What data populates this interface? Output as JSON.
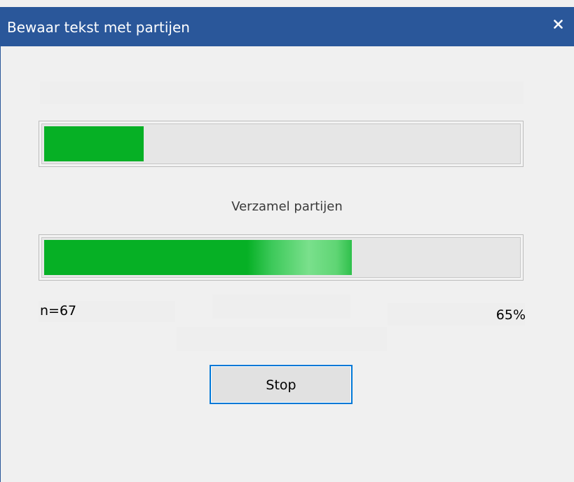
{
  "window": {
    "title": "Bewaar tekst met partijen",
    "close_symbol": "✕"
  },
  "progress_primary": {
    "fraction": 0.21
  },
  "status": {
    "label": "Verzamel partijen"
  },
  "progress_secondary": {
    "fraction": 0.65
  },
  "stats": {
    "count": "n=67",
    "percent": "65%"
  },
  "buttons": {
    "stop_label": "Stop"
  },
  "colors": {
    "titlebar": "#2a579a",
    "progress_fill": "#06b025",
    "focus_border": "#0078d7"
  }
}
